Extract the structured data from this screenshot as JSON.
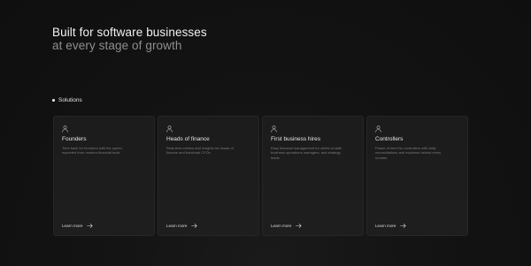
{
  "hero": {
    "title": "Built for software businesses",
    "subtitle": "at every stage of growth"
  },
  "section": {
    "label": "Solutions"
  },
  "cards": [
    {
      "icon": "user-icon",
      "title": "Founders",
      "description": "Time back for founders with the speed expected from modern financial tools",
      "link_label": "Learn more"
    },
    {
      "icon": "user-icon",
      "title": "Heads of finance",
      "description": "Real-time metrics and insights for heads of finance and fractional CFOs",
      "link_label": "Learn more"
    },
    {
      "icon": "user-icon",
      "title": "First business hires",
      "description": "Easy financial management for chiefs of staff, business operations managers, and strategy leads",
      "link_label": "Learn more"
    },
    {
      "icon": "user-icon",
      "title": "Controllers",
      "description": "Peace of mind for controllers with daily reconciliations and evidence behind every number",
      "link_label": "Learn more"
    }
  ],
  "colors": {
    "background": "#121212",
    "card": "#1d1d1d",
    "text_primary": "#f2f2f2",
    "text_secondary": "#8e8e8e"
  }
}
